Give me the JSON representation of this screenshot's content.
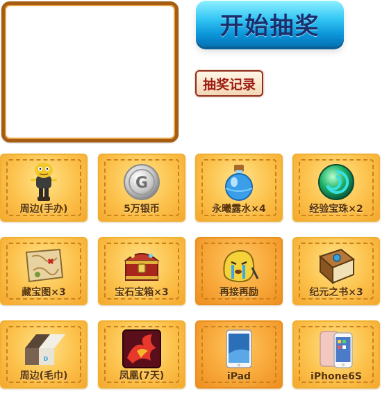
{
  "actions": {
    "start_label": "开始抽奖",
    "record_label": "抽奖记录"
  },
  "prizes": [
    {
      "label": "周边(手办)",
      "icon": "figure-icon"
    },
    {
      "label": "5万银币",
      "icon": "silver-coin-icon"
    },
    {
      "label": "永曦露水×4",
      "icon": "potion-bottle-icon"
    },
    {
      "label": "经验宝珠×2",
      "icon": "green-orb-icon"
    },
    {
      "label": "藏宝图×3",
      "icon": "treasure-map-icon"
    },
    {
      "label": "宝石宝箱×3",
      "icon": "treasure-chest-icon"
    },
    {
      "label": "再接再励",
      "icon": "crying-mascot-icon"
    },
    {
      "label": "纪元之书×3",
      "icon": "book-icon"
    },
    {
      "label": "周边(毛巾)",
      "icon": "towel-icon"
    },
    {
      "label": "凤凰(7天)",
      "icon": "phoenix-icon"
    },
    {
      "label": "iPad",
      "icon": "tablet-icon"
    },
    {
      "label": "iPhone6S",
      "icon": "phone-icon"
    }
  ],
  "colors": {
    "start_button": "#1ea9e6",
    "tile_gold": "#fcc24c",
    "panel_border": "#a65c12"
  }
}
